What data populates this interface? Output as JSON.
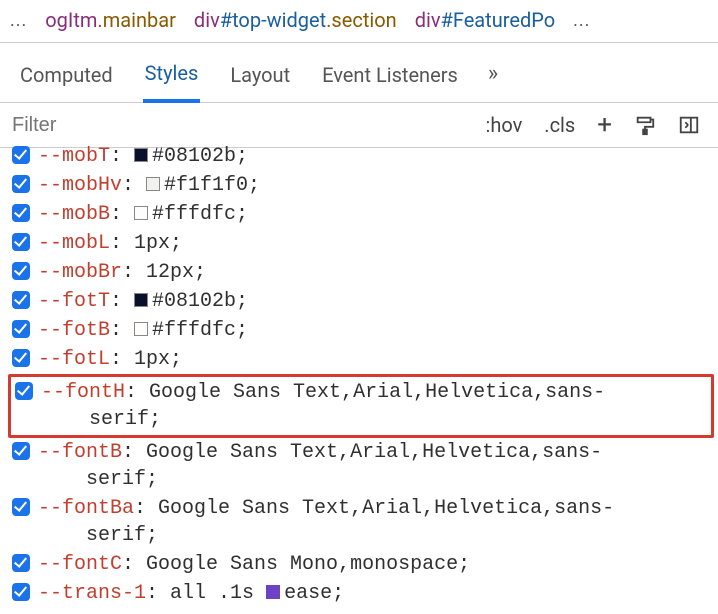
{
  "breadcrumb": {
    "left_ellipsis": "...",
    "right_ellipsis": "...",
    "items": [
      {
        "prefix": "ogItm",
        "cls": ".mainbar"
      },
      {
        "tag": "div",
        "id": "#top-widget",
        "cls": ".section"
      },
      {
        "tag": "div",
        "id": "#FeaturedPo"
      }
    ]
  },
  "tabs": {
    "computed": "Computed",
    "styles": "Styles",
    "layout": "Layout",
    "event_listeners": "Event Listeners",
    "more": "»"
  },
  "filter": {
    "placeholder": "Filter",
    "hov": ":hov",
    "cls": ".cls",
    "plus": "+"
  },
  "decls": [
    {
      "name": "--mobT",
      "swatch": "#08102b",
      "value": "#08102b;",
      "cut_top": true
    },
    {
      "name": "--mobHv",
      "swatch": "#f1f1f0",
      "value": "#f1f1f0;"
    },
    {
      "name": "--mobB",
      "swatch": "#fffdfc",
      "value": "#fffdfc;"
    },
    {
      "name": "--mobL",
      "value": "1px;"
    },
    {
      "name": "--mobBr",
      "value": "12px;"
    },
    {
      "name": "--fotT",
      "swatch": "#08102b",
      "value": "#08102b;"
    },
    {
      "name": "--fotB",
      "swatch": "#fffdfc",
      "value": "#fffdfc;"
    },
    {
      "name": "--fotL",
      "value": "1px;"
    },
    {
      "name": "--fontH",
      "value": "Google Sans Text,Arial,Helvetica,sans-",
      "cont": "serif;",
      "highlight": true
    },
    {
      "name": "--fontB",
      "value": "Google Sans Text,Arial,Helvetica,sans-",
      "cont": "serif;"
    },
    {
      "name": "--fontBa",
      "value": "Google Sans Text,Arial,Helvetica,sans-",
      "cont": "serif;"
    },
    {
      "name": "--fontC",
      "value": "Google Sans Mono,monospace;"
    },
    {
      "name": "--trans-1",
      "value_pre": "all .1s ",
      "swatch_inline": "purple",
      "value_post": "ease;"
    }
  ]
}
